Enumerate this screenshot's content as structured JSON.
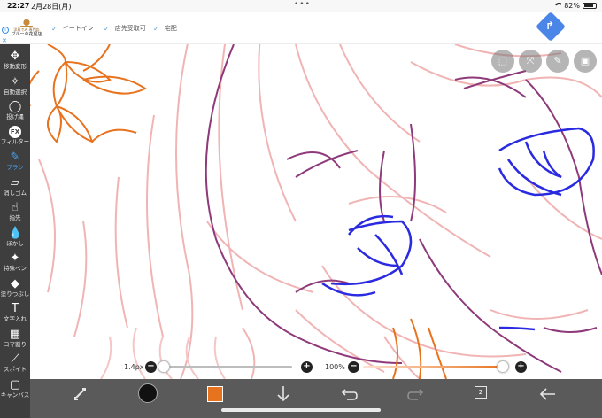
{
  "status_bar": {
    "time": "22:27",
    "date": "2月28日(月)",
    "dots": "•••",
    "battery": "82%"
  },
  "ad": {
    "info_icon": "i",
    "close_icon": "✕",
    "logo_small": "洋風でみ 専門店",
    "logo_name": "ブルーの花屋店",
    "features": [
      "イートイン",
      "店先受取可",
      "宅配"
    ],
    "check": "✓",
    "direction_arrow": "↱"
  },
  "toolbar": {
    "tools": [
      {
        "label": "移動変形",
        "icon": "✥"
      },
      {
        "label": "自動選択",
        "icon": "✧"
      },
      {
        "label": "投げ縄",
        "icon": "◯"
      },
      {
        "label": "フィルター",
        "icon": "FX"
      },
      {
        "label": "ブラシ",
        "icon": "✎"
      },
      {
        "label": "消しゴム",
        "icon": "▱"
      },
      {
        "label": "指先",
        "icon": "☝"
      },
      {
        "label": "ぼかし",
        "icon": "💧"
      },
      {
        "label": "特殊ペン",
        "icon": "✦"
      },
      {
        "label": "塗りつぶし",
        "icon": "◆"
      },
      {
        "label": "文字入れ",
        "icon": "T"
      },
      {
        "label": "コマ割り",
        "icon": "▦"
      },
      {
        "label": "スポイト",
        "icon": "⟋"
      },
      {
        "label": "キャンバス",
        "icon": "▢"
      }
    ]
  },
  "sliders": {
    "brush_size": {
      "label": "1.4px",
      "minus": "−",
      "plus": "+",
      "value_fraction": 0.02
    },
    "opacity": {
      "label": "100%",
      "minus": "−",
      "plus": "+",
      "value_fraction": 1.0
    }
  },
  "bottom_bar": {
    "layers_count": "2",
    "icons": [
      "swap-colors",
      "brush",
      "color",
      "import-arrow",
      "undo",
      "redo",
      "layers",
      "back"
    ]
  },
  "colors": {
    "current_color": "#e8731f",
    "toolbar_bg": "#3e3e3e",
    "active_tool": "#4aa3f0",
    "bottom_bg": "#5a5a5a"
  }
}
